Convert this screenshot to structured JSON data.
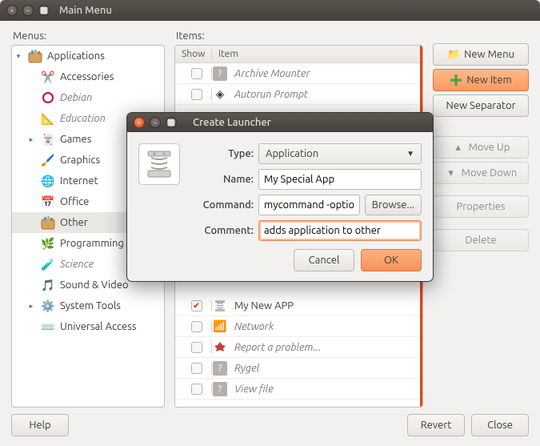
{
  "window": {
    "title": "Main Menu"
  },
  "labels": {
    "menus": "Menus:",
    "items": "Items:"
  },
  "tree": {
    "root": "Applications",
    "items": [
      {
        "label": "Accessories",
        "italic": false
      },
      {
        "label": "Debian",
        "italic": true
      },
      {
        "label": "Education",
        "italic": true
      },
      {
        "label": "Games",
        "italic": false,
        "expandable": true
      },
      {
        "label": "Graphics",
        "italic": false
      },
      {
        "label": "Internet",
        "italic": false
      },
      {
        "label": "Office",
        "italic": false
      },
      {
        "label": "Other",
        "italic": false,
        "selected": true
      },
      {
        "label": "Programming",
        "italic": false
      },
      {
        "label": "Science",
        "italic": true
      },
      {
        "label": "Sound & Video",
        "italic": false
      },
      {
        "label": "System Tools",
        "italic": false,
        "expandable": true
      },
      {
        "label": "Universal Access",
        "italic": false
      }
    ]
  },
  "items": {
    "headers": {
      "show": "Show",
      "item": "Item"
    },
    "rows": [
      {
        "label": "Archive Mounter",
        "italic": true,
        "checked": false
      },
      {
        "label": "Autorun Prompt",
        "italic": true,
        "checked": false
      },
      {
        "label": "My New APP",
        "italic": false,
        "checked": true
      },
      {
        "label": "Network",
        "italic": true,
        "checked": false
      },
      {
        "label": "Report a problem...",
        "italic": true,
        "checked": false
      },
      {
        "label": "Rygel",
        "italic": true,
        "checked": false
      },
      {
        "label": "View file",
        "italic": true,
        "checked": false
      }
    ]
  },
  "buttons": {
    "new_menu": "New Menu",
    "new_item": "New Item",
    "new_separator": "New Separator",
    "move_up": "Move Up",
    "move_down": "Move Down",
    "properties": "Properties",
    "delete": "Delete",
    "help": "Help",
    "revert": "Revert",
    "close": "Close"
  },
  "dialog": {
    "title": "Create Launcher",
    "type_label": "Type:",
    "type_value": "Application",
    "name_label": "Name:",
    "name_value": "My Special App",
    "command_label": "Command:",
    "command_value": "mycommand -options",
    "browse": "Browse...",
    "comment_label": "Comment:",
    "comment_value": "adds application to other",
    "cancel": "Cancel",
    "ok": "OK"
  }
}
